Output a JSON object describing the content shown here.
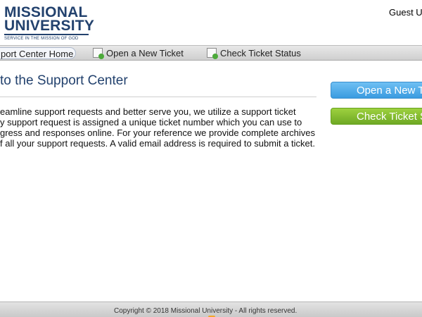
{
  "header": {
    "logo_line1": "MISSIONAL",
    "logo_line2": "UNIVERSITY",
    "logo_tagline": "SERVICE IN THE MISSION OF GOD",
    "user_text": "Guest U"
  },
  "nav": {
    "home": "port Center Home",
    "new_ticket": "Open a New Ticket",
    "check_status": "Check Ticket Status"
  },
  "main": {
    "title": "to the Support Center",
    "intro_lines": [
      "eamline support requests and better serve you, we utilize a support ticket",
      "y support request is assigned a unique ticket number which you can use to",
      "gress and responses online. For your reference we provide complete archives",
      "f all your support requests. A valid email address is required to submit a ticket."
    ]
  },
  "sidebar": {
    "open_button": "Open a New T",
    "check_button": "Check Ticket S"
  },
  "footer": {
    "copyright": "Copyright © 2018 Missional University - All rights reserved."
  },
  "colors": {
    "brand_navy": "#23426e",
    "open_button_blue": "#3a9be0",
    "check_button_green": "#6ea924"
  },
  "icons": {
    "nav_new_ticket": "new-ticket-icon",
    "nav_check_status": "check-status-icon"
  }
}
